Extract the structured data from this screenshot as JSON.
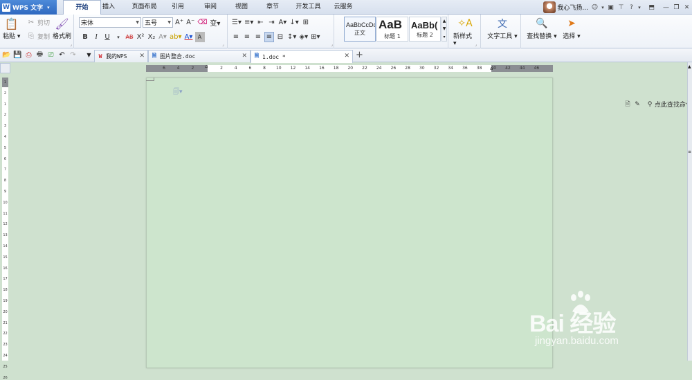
{
  "app": {
    "name": "WPS 文字"
  },
  "menu_tabs": [
    {
      "label": "开始",
      "active": true
    },
    {
      "label": "插入"
    },
    {
      "label": "页面布局"
    },
    {
      "label": "引用"
    },
    {
      "label": "审阅"
    },
    {
      "label": "视图"
    },
    {
      "label": "章节"
    },
    {
      "label": "开发工具"
    },
    {
      "label": "云服务"
    }
  ],
  "user": {
    "name": "我心飞扬..."
  },
  "ribbon": {
    "paste": "粘贴",
    "cut": "剪切",
    "copy": "复制",
    "format_painter": "格式刷",
    "font_name": "宋体",
    "font_size": "五号",
    "bold": "B",
    "italic": "I",
    "underline": "U",
    "strike": "AB",
    "superscript": "X²",
    "subscript": "X₂",
    "styles": [
      {
        "sample": "AaBbCcDd",
        "name": "正文",
        "selected": true
      },
      {
        "sample": "AaB",
        "name": "标题 1"
      },
      {
        "sample": "AaBb(",
        "name": "标题 2"
      }
    ],
    "new_style": "新样式",
    "text_tools": "文字工具",
    "find_replace": "查找替换",
    "select": "选择"
  },
  "doc_tabs": [
    {
      "label": "我的WPS"
    },
    {
      "label": "图片整合.doc"
    },
    {
      "label": "1.doc *",
      "active": true
    }
  ],
  "search_command": "点此查找命令",
  "ruler": {
    "h_ticks": [
      "6",
      "4",
      "2",
      "2",
      "4",
      "6",
      "8",
      "10",
      "12",
      "14",
      "16",
      "18",
      "20",
      "22",
      "24",
      "26",
      "28",
      "30",
      "32",
      "34",
      "36",
      "38",
      "40",
      "42",
      "44",
      "46"
    ],
    "v_ticks": [
      "1",
      "2",
      "1",
      "2",
      "3",
      "4",
      "5",
      "6",
      "7",
      "8",
      "9",
      "10",
      "11",
      "12",
      "13",
      "14",
      "15",
      "16",
      "17",
      "18",
      "19",
      "20",
      "21",
      "22",
      "23",
      "24",
      "25",
      "26"
    ]
  },
  "watermark": {
    "main": "Bai 经验",
    "sub": "jingyan.baidu.com"
  },
  "colors": {
    "accent": "#2f69c0",
    "page_bg": "#cde5cd",
    "desk_bg": "#cfe1cf"
  }
}
